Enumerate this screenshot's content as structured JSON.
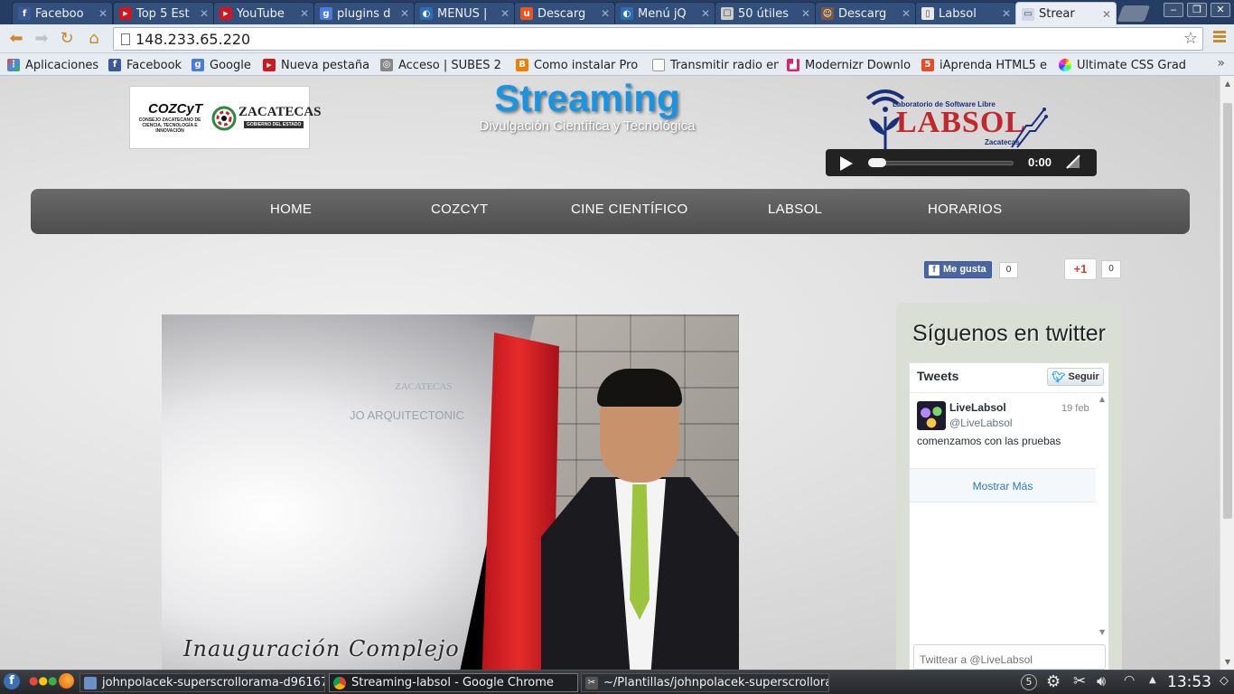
{
  "browser": {
    "tabs": [
      {
        "label": "Faceboo",
        "icon": "facebook-icon",
        "color": "#3b5998",
        "glyph": "f"
      },
      {
        "label": "Top 5 Est",
        "icon": "youtube-icon",
        "color": "#cc181e",
        "glyph": "▶"
      },
      {
        "label": "YouTube",
        "icon": "youtube-icon",
        "color": "#cc181e",
        "glyph": "▶"
      },
      {
        "label": "plugins d",
        "icon": "google-icon",
        "color": "#4a7be0",
        "glyph": "g"
      },
      {
        "label": "MENÚS |",
        "icon": "page-icon",
        "color": "#2a6db3",
        "glyph": "◐"
      },
      {
        "label": "Descarg",
        "icon": "ubuntu-icon",
        "color": "#e95420",
        "glyph": "u"
      },
      {
        "label": "Menú jQ",
        "icon": "page-icon",
        "color": "#2a6db3",
        "glyph": "◐"
      },
      {
        "label": "50 útiles",
        "icon": "chat-icon",
        "color": "#cccccc",
        "glyph": "☐"
      },
      {
        "label": "Descarg",
        "icon": "avatar-icon",
        "color": "#7a5a3a",
        "glyph": "☺"
      },
      {
        "label": "Labsol",
        "icon": "page-icon",
        "color": "#e8e8e8",
        "glyph": "▯"
      },
      {
        "label": "Strear",
        "icon": "page-icon",
        "color": "#d0d8e8",
        "glyph": "▭",
        "active": true
      }
    ],
    "url": "148.233.65.220",
    "bookmarks": [
      {
        "label": "Aplicaciones",
        "icon": "apps-grid-icon",
        "color": "#e84a3a",
        "glyph": "⋮"
      },
      {
        "label": "Facebook",
        "icon": "facebook-icon",
        "color": "#3b5998",
        "glyph": "f"
      },
      {
        "label": "Google",
        "icon": "google-icon",
        "color": "#4a7be0",
        "glyph": "g"
      },
      {
        "label": "Nueva pestaña",
        "icon": "youtube-icon",
        "color": "#cc181e",
        "glyph": "▶"
      },
      {
        "label": "Acceso | SUBES 2",
        "icon": "globe-icon",
        "color": "#888888",
        "glyph": "◎"
      },
      {
        "label": "Como instalar Pro",
        "icon": "blogger-icon",
        "color": "#f57d00",
        "glyph": "B"
      },
      {
        "label": "Transmitir radio en",
        "icon": "page-icon",
        "color": "#ffffff",
        "glyph": ""
      },
      {
        "label": "Modernizr Downlo",
        "icon": "modernizr-icon",
        "color": "#d6246e",
        "glyph": "▟"
      },
      {
        "label": "iAprenda HTML5 e",
        "icon": "html5-icon",
        "color": "#e44d26",
        "glyph": "5"
      },
      {
        "label": "Ultimate CSS Grad",
        "icon": "color-wheel-icon",
        "color": "#c040c0",
        "glyph": "●"
      }
    ]
  },
  "site": {
    "title": "Streaming",
    "subtitle": "Divulgación Científica y Tecnológica",
    "cozcyt_logo": {
      "name": "COZCyT",
      "caption": "CONSEJO ZACATECANO DE CIENCIA, TECNOLOGÍA E INNOVACIÓN",
      "state": "ZACATECAS",
      "state_caption": "GOBIERNO DEL ESTADO"
    },
    "labsol_logo": {
      "top": "Laboratorio de Software Libre",
      "name": "LABSOL",
      "bottom": "Zacatecas"
    },
    "audio_player": {
      "time": "0:00",
      "progress": 0
    },
    "nav": [
      "HOME",
      "COZCYT",
      "CINE CIENTÍFICO",
      "LABSOL",
      "HORARIOS"
    ],
    "social": {
      "fb_label": "Me gusta",
      "fb_count": "0",
      "gplus_label": "+1",
      "gplus_count": "0"
    },
    "video": {
      "caption": "Inauguración Complejo",
      "plaque_line1": "ZACATECAS",
      "plaque_line2": "JO ARQUITECTONIC"
    },
    "twitter": {
      "heading": "Síguenos en twitter",
      "tweets_label": "Tweets",
      "follow_label": "Seguir",
      "tweet": {
        "name": "LiveLabsol",
        "handle": "@LiveLabsol",
        "date": "19 feb",
        "text": "comenzamos con las pruebas"
      },
      "show_more": "Mostrar Más",
      "compose_placeholder": "Twittear a @LiveLabsol"
    }
  },
  "taskbar": {
    "tasks": [
      {
        "label": "johnpolacek-superscrollorama-d96167",
        "icon": "document-icon"
      },
      {
        "label": "Streaming-labsol - Google Chrome",
        "icon": "chrome-icon",
        "active": true
      },
      {
        "label": "~/Plantillas/johnpolacek-superscrollorar",
        "icon": "terminal-icon"
      }
    ],
    "workspace": "5",
    "clock": "13:53"
  }
}
